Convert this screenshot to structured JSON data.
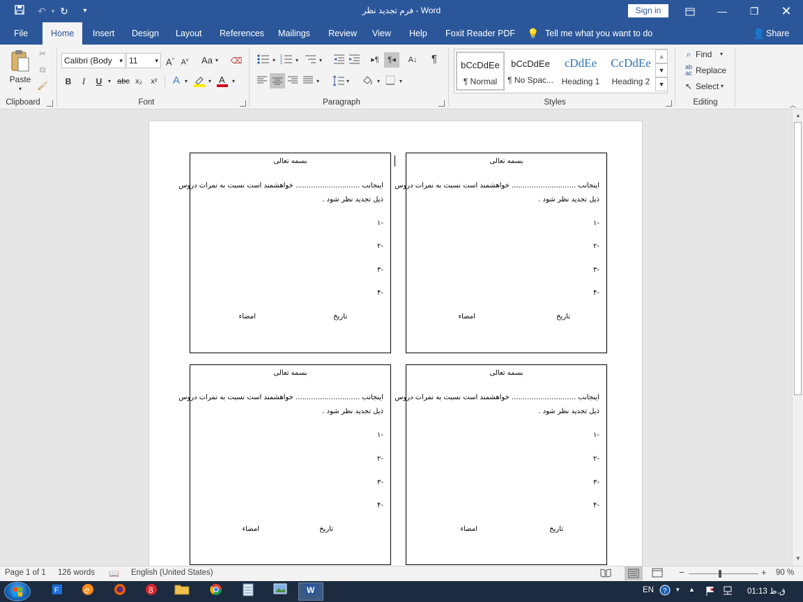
{
  "titlebar": {
    "title": "فرم تجدید نظر  -  Word",
    "sign_in": "Sign in",
    "icons": [
      "save-icon",
      "undo-icon",
      "redo-icon",
      "customize-qat-icon",
      "ribbon-display-icon",
      "minimize-icon",
      "restore-icon",
      "close-icon"
    ]
  },
  "tabs": [
    "File",
    "Home",
    "Insert",
    "Design",
    "Layout",
    "References",
    "Mailings",
    "Review",
    "View",
    "Help",
    "Foxit Reader PDF"
  ],
  "tell_me": "Tell me what you want to do",
  "share": "Share",
  "ribbon": {
    "clipboard": {
      "paste": "Paste",
      "label": "Clipboard"
    },
    "font": {
      "font_name": "Calibri (Body",
      "font_size": "11",
      "change_case": "Aa",
      "bold": "B",
      "italic": "I",
      "underline": "U",
      "strike": "abc",
      "subscript": "x₂",
      "superscript": "x²",
      "label": "Font"
    },
    "paragraph": {
      "label": "Paragraph"
    },
    "styles": {
      "label": "Styles",
      "items": [
        {
          "sample": "bCcDdEe",
          "name": "¶ Normal"
        },
        {
          "sample": "bCcDdEe",
          "name": "¶ No Spac..."
        },
        {
          "sample": "cDdEe",
          "name": "Heading 1"
        },
        {
          "sample": "CcDdEe",
          "name": "Heading 2"
        }
      ]
    },
    "editing": {
      "find": "Find",
      "replace": "Replace",
      "select": "Select",
      "label": "Editing"
    }
  },
  "document": {
    "cards": [
      {
        "title": "بسمه تعالی",
        "line1": "اینجانب ............................. خواهشمند است نسبت به نمرات دروس",
        "line2": "ذیل تجدید نظر شود .",
        "items": [
          "-۱",
          "-۲",
          "-۳",
          "-۴"
        ],
        "date": "تاریخ",
        "sign": "امضاء"
      },
      {
        "title": "بسمه تعالی",
        "line1": "اینجانب ............................. خواهشمند است نسبت به نمرات دروس",
        "line2": "ذیل تجدید نظر شود .",
        "items": [
          "-۱",
          "-۲",
          "-۳",
          "-۴"
        ],
        "date": "تاریخ",
        "sign": "امضاء"
      },
      {
        "title": "بسمه تعالی",
        "line1": "اینجانب ............................. خواهشمند است نسبت به نمرات دروس",
        "line2": "ذیل تجدید نظر شود .",
        "items": [
          "-۱",
          "-۲",
          "-۳",
          "-۴"
        ],
        "date": "تاریخ",
        "sign": "امضاء"
      },
      {
        "title": "بسمه تعالی",
        "line1": "اینجانب ............................. خواهشمند است نسبت به نمرات دروس",
        "line2": "ذیل تجدید نظر شود .",
        "items": [
          "-۱",
          "-۲",
          "-۳",
          "-۴"
        ],
        "date": "تاریخ",
        "sign": "امضاء"
      }
    ]
  },
  "statusbar": {
    "page": "Page 1 of 1",
    "words": "126 words",
    "language": "English (United States)",
    "zoom": "90 %",
    "zoom_minus": "−",
    "zoom_plus": "+"
  },
  "taskbar": {
    "language": "EN",
    "time": "01:13 ق.ظ"
  }
}
